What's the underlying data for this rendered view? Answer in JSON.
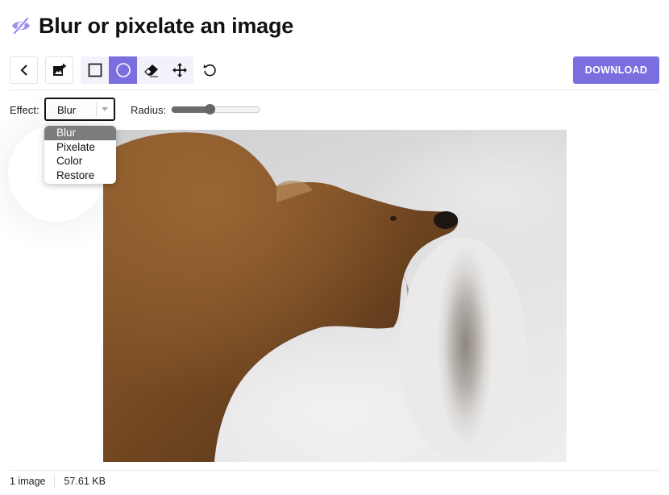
{
  "header": {
    "title": "Blur or pixelate an image",
    "icon": "eye-slash-icon",
    "accent_color": "#7b6fe0"
  },
  "toolbar": {
    "back_icon": "chevron-left-icon",
    "add_image_icon": "add-image-icon",
    "tools": [
      {
        "name": "rectangle",
        "icon": "square-icon",
        "active": false
      },
      {
        "name": "ellipse",
        "icon": "circle-icon",
        "active": true
      },
      {
        "name": "eraser",
        "icon": "eraser-icon",
        "active": false
      },
      {
        "name": "move",
        "icon": "move-icon",
        "active": false
      }
    ],
    "reset_icon": "rotate-ccw-icon",
    "download_label": "DOWNLOAD"
  },
  "controls": {
    "effect_label": "Effect:",
    "effect_value": "Blur",
    "effect_options": [
      "Blur",
      "Pixelate",
      "Color",
      "Restore"
    ],
    "radius_label": "Radius:",
    "radius_fraction": 0.43
  },
  "canvas": {
    "description": "Photo of a brown bear against white water with a blurred ellipse region near its mouth"
  },
  "footer": {
    "image_count": "1 image",
    "file_size": "57.61 KB"
  }
}
